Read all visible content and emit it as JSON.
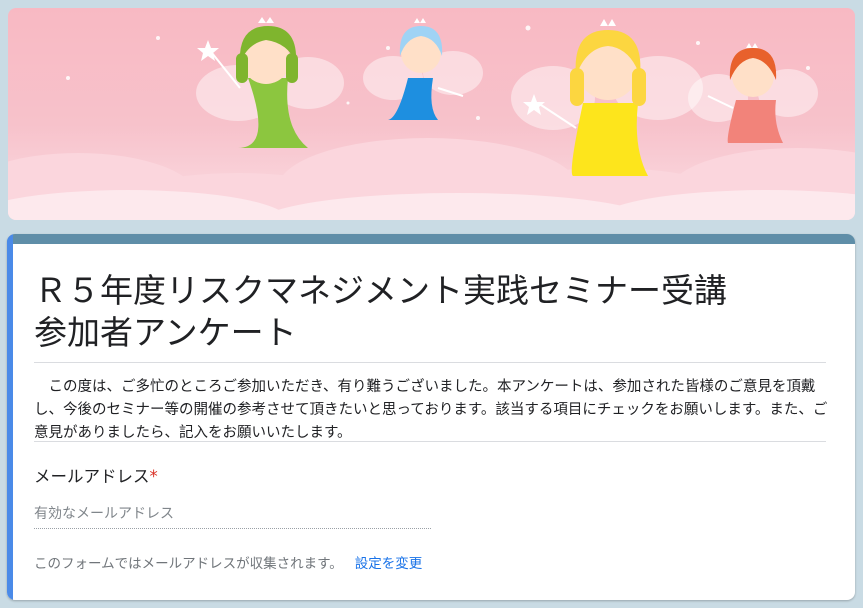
{
  "colors": {
    "background": "#c9dbe4",
    "banner_pink": "#f8b9c3",
    "card_top_bar": "#5f8ea8",
    "card_left_accent": "#4a8ae8",
    "required_mark": "#d93025",
    "link": "#1a73e8"
  },
  "banner": {
    "description_icon": "fairies-header-illustration"
  },
  "form": {
    "title_line1": "Ｒ５年度リスクマネジメント実践セミナー受講",
    "title_line2": "参加者アンケート",
    "description": "この度は、ご多忙のところご参加いただき、有り難うございました。本アンケートは、参加された皆様のご意見を頂戴し、今後のセミナー等の開催の参考させて頂きたいと思っております。該当する項目にチェックをお願いします。また、ご意見がありましたら、記入をお願いいたします。"
  },
  "email_question": {
    "label": "メールアドレス",
    "required_mark": "*",
    "placeholder": "有効なメールアドレス",
    "value": ""
  },
  "collection_note": {
    "text": "このフォームではメールアドレスが収集されます。",
    "link_label": "設定を変更"
  }
}
